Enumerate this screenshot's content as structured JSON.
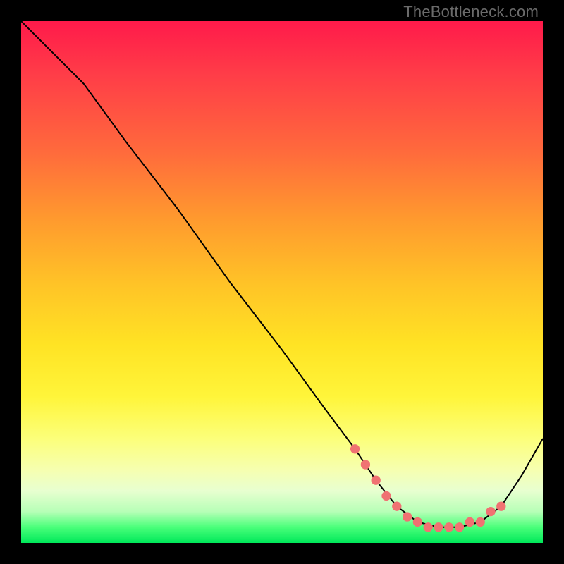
{
  "watermark": {
    "text": "TheBottleneck.com"
  },
  "colors": {
    "background": "#000000",
    "curve": "#000000",
    "dot": "#f07272",
    "gradient_top": "#ff1a4a",
    "gradient_bottom": "#00e85a"
  },
  "chart_data": {
    "type": "line",
    "title": "",
    "xlabel": "",
    "ylabel": "",
    "xlim": [
      0,
      100
    ],
    "ylim": [
      0,
      100
    ],
    "grid": false,
    "legend": false,
    "annotations": [
      "TheBottleneck.com"
    ],
    "series": [
      {
        "name": "bottleneck-curve",
        "x": [
          0,
          4,
          8,
          12,
          20,
          30,
          40,
          50,
          58,
          64,
          68,
          72,
          76,
          80,
          84,
          88,
          92,
          96,
          100
        ],
        "y": [
          100,
          96,
          92,
          88,
          77,
          64,
          50,
          37,
          26,
          18,
          12,
          7,
          4,
          3,
          3,
          4,
          7,
          13,
          20
        ]
      }
    ],
    "highlight_points": {
      "name": "valley-dots",
      "x": [
        64,
        66,
        68,
        70,
        72,
        74,
        76,
        78,
        80,
        82,
        84,
        86,
        88,
        90,
        92
      ],
      "y": [
        18,
        15,
        12,
        9,
        7,
        5,
        4,
        3,
        3,
        3,
        3,
        4,
        4,
        6,
        7
      ]
    },
    "background_gradient": {
      "stops": [
        {
          "pos": 0.0,
          "color": "#ff1a4a"
        },
        {
          "pos": 0.25,
          "color": "#ff6a3c"
        },
        {
          "pos": 0.5,
          "color": "#ffc227"
        },
        {
          "pos": 0.72,
          "color": "#fff53a"
        },
        {
          "pos": 0.9,
          "color": "#e8ffd0"
        },
        {
          "pos": 1.0,
          "color": "#00e85a"
        }
      ]
    }
  }
}
